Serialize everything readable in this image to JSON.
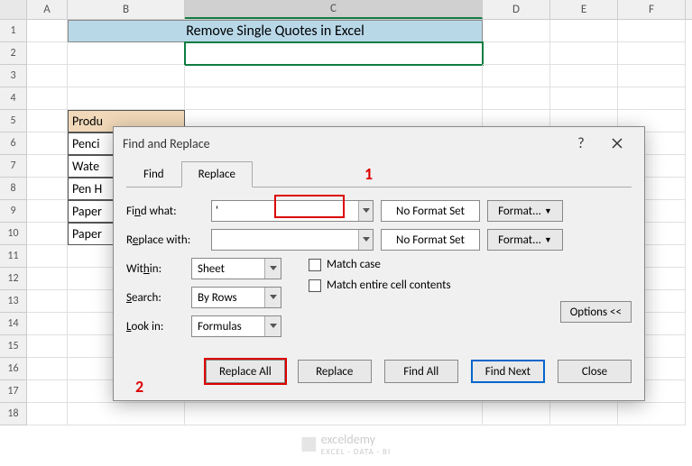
{
  "columns": [
    "A",
    "B",
    "C",
    "D",
    "E",
    "F"
  ],
  "rows": [
    1,
    2,
    3,
    4,
    5,
    6,
    7,
    8,
    9,
    10,
    11,
    12,
    13,
    14,
    15,
    16,
    17,
    18
  ],
  "title_cell": "Remove Single Quotes in Excel",
  "product_header": "Produ",
  "products": [
    "Penci",
    "Wate",
    "Pen H",
    "Paper",
    "Paper"
  ],
  "dialog": {
    "title": "Find and Replace",
    "help": "?",
    "tabs": {
      "find": "Find",
      "replace": "Replace"
    },
    "find_what_label": "Find what:",
    "replace_with_label": "Replace with:",
    "find_value": "'",
    "no_format": "No Format Set",
    "format_btn": "Format...",
    "within_label": "Within:",
    "within_val": "Sheet",
    "search_label": "Search:",
    "search_val": "By Rows",
    "lookin_label": "Look in:",
    "lookin_val": "Formulas",
    "match_case": "Match case",
    "match_contents": "Match entire cell contents",
    "options_btn": "Options <<",
    "replace_all": "Replace All",
    "replace_btn": "Replace",
    "find_all": "Find All",
    "find_next": "Find Next",
    "close_btn": "Close"
  },
  "annotations": {
    "a1": "1",
    "a2": "2"
  },
  "watermark": {
    "name": "exceldemy",
    "sub": "EXCEL · DATA · BI"
  }
}
